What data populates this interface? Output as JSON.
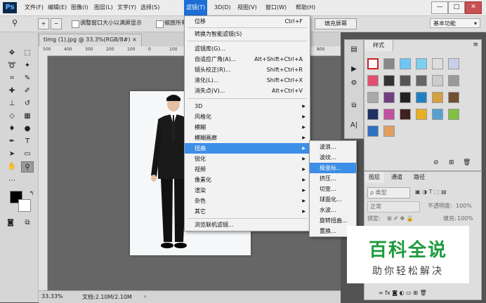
{
  "app": {
    "logo": "Ps"
  },
  "menubar": {
    "items": [
      "文件(F)",
      "编辑(E)",
      "图像(I)",
      "图层(L)",
      "文字(Y)",
      "选择(S)",
      "滤镜(T)",
      "3D(D)",
      "视图(V)",
      "窗口(W)",
      "帮助(H)"
    ],
    "active_index": 6,
    "window_controls": [
      "—",
      "□",
      "✕"
    ]
  },
  "options_bar": {
    "resize_label": "调整窗口大小以满屏显示",
    "zoom_all_label": "缩放所有",
    "fill_screen_label": "填充屏幕",
    "workspace_label": "基本功能"
  },
  "document": {
    "tab_title": "timg (1).jpg @ 33.3%(RGB/8#)",
    "tab_close": "×",
    "ruler_ticks": [
      "500",
      "400",
      "300",
      "200",
      "100",
      "0",
      "100",
      "200",
      "300",
      "400",
      "500",
      "600",
      "700",
      "800"
    ],
    "zoom": "33.33%",
    "doc_info": "文档:2.10M/2.10M"
  },
  "filter_menu": {
    "items": [
      {
        "label": "位移",
        "shortcut": "Ctrl+F"
      },
      {
        "label": "转换为智能滤镜(S)",
        "shortcut": ""
      },
      {
        "label": "滤镜库(G)...",
        "shortcut": ""
      },
      {
        "label": "自适应广角(A)...",
        "shortcut": "Alt+Shift+Ctrl+A"
      },
      {
        "label": "镜头校正(R)...",
        "shortcut": "Shift+Ctrl+R"
      },
      {
        "label": "液化(L)...",
        "shortcut": "Shift+Ctrl+X"
      },
      {
        "label": "消失点(V)...",
        "shortcut": "Alt+Ctrl+V"
      },
      {
        "label": "3D",
        "shortcut": ""
      },
      {
        "label": "风格化",
        "shortcut": ""
      },
      {
        "label": "模糊",
        "shortcut": ""
      },
      {
        "label": "模糊画廊",
        "shortcut": ""
      },
      {
        "label": "扭曲",
        "shortcut": ""
      },
      {
        "label": "锐化",
        "shortcut": ""
      },
      {
        "label": "视频",
        "shortcut": ""
      },
      {
        "label": "像素化",
        "shortcut": ""
      },
      {
        "label": "渲染",
        "shortcut": ""
      },
      {
        "label": "杂色",
        "shortcut": ""
      },
      {
        "label": "其它",
        "shortcut": ""
      },
      {
        "label": "浏览联机滤镜...",
        "shortcut": ""
      }
    ],
    "highlighted": "扭曲"
  },
  "distort_submenu": {
    "items": [
      "波浪...",
      "波纹...",
      "极坐标...",
      "挤压...",
      "切变...",
      "球面化...",
      "水波...",
      "旋转扭曲...",
      "置换..."
    ],
    "highlighted": "极坐标..."
  },
  "styles_panel": {
    "tab": "样式"
  },
  "layers_panel": {
    "tabs": [
      "图层",
      "通道",
      "路径"
    ],
    "kind_label": "ρ 类型",
    "blend_mode": "正常",
    "opacity_label": "不透明度:",
    "opacity_value": "100%",
    "lock_label": "锁定:",
    "fill_label": "填充:",
    "fill_value": "100%"
  },
  "watermark": {
    "title": "百科全说",
    "subtitle": "助你轻松解决"
  },
  "colors": {
    "accent": "#3d8ee6",
    "menubar_active": "#1d6fd6",
    "watermark_green": "#1d9b3c"
  }
}
